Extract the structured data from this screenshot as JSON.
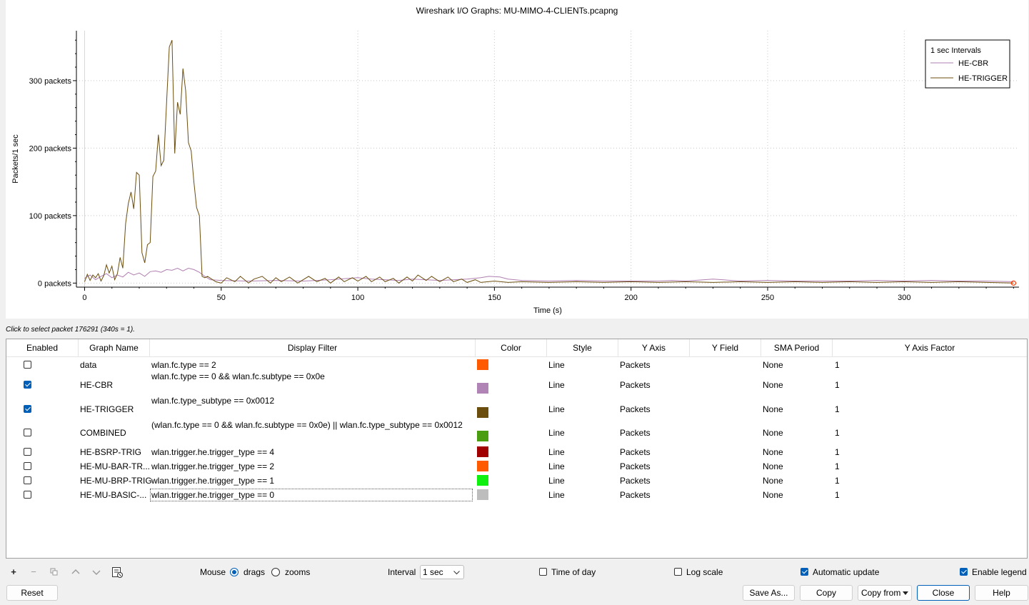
{
  "window": {
    "title": "Wireshark I/O Graphs: MU-MIMO-4-CLIENTs.pcapng"
  },
  "status_hint": "Click to select packet 176291 (340s = 1).",
  "chart_data": {
    "type": "line",
    "title": "Wireshark I/O Graphs: MU-MIMO-4-CLIENTs.pcapng",
    "xlabel": "Time (s)",
    "ylabel": "Packets/1 sec",
    "xlim": [
      -3,
      342
    ],
    "ylim": [
      -6,
      374
    ],
    "xticks": [
      0,
      50,
      100,
      150,
      200,
      250,
      300
    ],
    "yticks": [
      0,
      100,
      200,
      300
    ],
    "ytick_labels": [
      "0 packets",
      "100 packets",
      "200 packets",
      "300 packets"
    ],
    "grid": true,
    "legend": {
      "title": "1 sec Intervals",
      "position": "top-right"
    },
    "series": [
      {
        "name": "HE-CBR",
        "color": "#b07fb0",
        "points": [
          [
            0,
            7
          ],
          [
            2,
            12
          ],
          [
            4,
            5
          ],
          [
            6,
            10
          ],
          [
            8,
            14
          ],
          [
            10,
            8
          ],
          [
            12,
            12
          ],
          [
            14,
            9
          ],
          [
            16,
            16
          ],
          [
            18,
            12
          ],
          [
            20,
            15
          ],
          [
            22,
            10
          ],
          [
            24,
            17
          ],
          [
            26,
            18
          ],
          [
            28,
            16
          ],
          [
            30,
            20
          ],
          [
            32,
            19
          ],
          [
            34,
            22
          ],
          [
            36,
            18
          ],
          [
            38,
            22
          ],
          [
            40,
            20
          ],
          [
            42,
            16
          ],
          [
            44,
            10
          ],
          [
            46,
            5
          ],
          [
            50,
            4
          ],
          [
            60,
            3
          ],
          [
            70,
            4
          ],
          [
            80,
            3
          ],
          [
            90,
            5
          ],
          [
            100,
            8
          ],
          [
            105,
            6
          ],
          [
            110,
            5
          ],
          [
            115,
            4
          ],
          [
            120,
            6
          ],
          [
            130,
            4
          ],
          [
            140,
            6
          ],
          [
            145,
            8
          ],
          [
            148,
            10
          ],
          [
            152,
            9
          ],
          [
            155,
            6
          ],
          [
            160,
            4
          ],
          [
            170,
            3
          ],
          [
            180,
            4
          ],
          [
            190,
            3
          ],
          [
            200,
            3
          ],
          [
            210,
            3
          ],
          [
            215,
            4
          ],
          [
            220,
            3
          ],
          [
            230,
            6
          ],
          [
            240,
            3
          ],
          [
            250,
            4
          ],
          [
            260,
            3
          ],
          [
            270,
            3
          ],
          [
            280,
            3
          ],
          [
            290,
            4
          ],
          [
            300,
            3
          ],
          [
            310,
            4
          ],
          [
            320,
            3
          ],
          [
            330,
            3
          ],
          [
            340,
            2
          ]
        ]
      },
      {
        "name": "HE-TRIGGER",
        "color": "#6b4e0e",
        "points": [
          [
            0,
            2
          ],
          [
            1,
            13
          ],
          [
            2,
            4
          ],
          [
            3,
            12
          ],
          [
            4,
            8
          ],
          [
            5,
            14
          ],
          [
            6,
            3
          ],
          [
            7,
            11
          ],
          [
            8,
            27
          ],
          [
            9,
            15
          ],
          [
            10,
            25
          ],
          [
            11,
            5
          ],
          [
            12,
            14
          ],
          [
            13,
            38
          ],
          [
            14,
            22
          ],
          [
            15,
            88
          ],
          [
            16,
            118
          ],
          [
            17,
            135
          ],
          [
            18,
            110
          ],
          [
            19,
            164
          ],
          [
            20,
            160
          ],
          [
            21,
            45
          ],
          [
            22,
            30
          ],
          [
            23,
            57
          ],
          [
            24,
            60
          ],
          [
            25,
            158
          ],
          [
            26,
            166
          ],
          [
            27,
            220
          ],
          [
            28,
            174
          ],
          [
            29,
            182
          ],
          [
            30,
            268
          ],
          [
            31,
            350
          ],
          [
            32,
            360
          ],
          [
            33,
            192
          ],
          [
            34,
            268
          ],
          [
            35,
            250
          ],
          [
            36,
            318
          ],
          [
            37,
            285
          ],
          [
            38,
            208
          ],
          [
            39,
            196
          ],
          [
            40,
            150
          ],
          [
            41,
            112
          ],
          [
            42,
            100
          ],
          [
            43,
            10
          ],
          [
            44,
            8
          ],
          [
            45,
            10
          ],
          [
            48,
            2
          ],
          [
            50,
            0
          ],
          [
            52,
            8
          ],
          [
            55,
            2
          ],
          [
            57,
            10
          ],
          [
            60,
            0
          ],
          [
            62,
            6
          ],
          [
            65,
            10
          ],
          [
            68,
            0
          ],
          [
            70,
            8
          ],
          [
            72,
            2
          ],
          [
            75,
            9
          ],
          [
            78,
            0
          ],
          [
            82,
            10
          ],
          [
            85,
            2
          ],
          [
            88,
            7
          ],
          [
            90,
            0
          ],
          [
            93,
            9
          ],
          [
            95,
            2
          ],
          [
            98,
            8
          ],
          [
            100,
            3
          ],
          [
            103,
            10
          ],
          [
            105,
            2
          ],
          [
            108,
            9
          ],
          [
            110,
            2
          ],
          [
            113,
            7
          ],
          [
            115,
            0
          ],
          [
            118,
            9
          ],
          [
            120,
            3
          ],
          [
            122,
            12
          ],
          [
            125,
            4
          ],
          [
            127,
            10
          ],
          [
            130,
            2
          ],
          [
            133,
            9
          ],
          [
            135,
            2
          ],
          [
            138,
            6
          ],
          [
            140,
            1
          ],
          [
            143,
            5
          ],
          [
            145,
            1
          ],
          [
            150,
            3
          ],
          [
            155,
            1
          ],
          [
            160,
            2
          ],
          [
            170,
            1
          ],
          [
            180,
            2
          ],
          [
            190,
            1
          ],
          [
            200,
            2
          ],
          [
            210,
            1
          ],
          [
            220,
            2
          ],
          [
            230,
            1
          ],
          [
            240,
            2
          ],
          [
            250,
            1
          ],
          [
            260,
            2
          ],
          [
            270,
            1
          ],
          [
            280,
            2
          ],
          [
            290,
            1
          ],
          [
            300,
            2
          ],
          [
            310,
            1
          ],
          [
            320,
            2
          ],
          [
            330,
            1
          ],
          [
            340,
            0
          ]
        ]
      }
    ]
  },
  "table": {
    "headers": [
      "Enabled",
      "Graph Name",
      "Display Filter",
      "Color",
      "Style",
      "Y Axis",
      "Y Field",
      "SMA Period",
      "Y Axis Factor"
    ],
    "rows": [
      {
        "enabled": false,
        "name": "data",
        "filter": "wlan.fc.type == 2",
        "color": "#ff5a00",
        "style": "Line",
        "y_axis": "Packets",
        "y_field": "",
        "sma": "None",
        "factor": "1"
      },
      {
        "enabled": true,
        "name": "HE-CBR",
        "filter": "wlan.fc.type == 0 && wlan.fc.subtype == 0x0e",
        "color": "#b085b5",
        "style": "Line",
        "y_axis": "Packets",
        "y_field": "",
        "sma": "None",
        "factor": "1"
      },
      {
        "enabled": true,
        "name": "HE-TRIGGER",
        "filter": "wlan.fc.type_subtype == 0x0012",
        "color": "#6b4e0e",
        "style": "Line",
        "y_axis": "Packets",
        "y_field": "",
        "sma": "None",
        "factor": "1"
      },
      {
        "enabled": false,
        "name": "COMBINED",
        "filter": "(wlan.fc.type == 0 && wlan.fc.subtype == 0x0e) || wlan.fc.type_subtype == 0x0012",
        "color": "#4a9c11",
        "style": "Line",
        "y_axis": "Packets",
        "y_field": "",
        "sma": "None",
        "factor": "1"
      },
      {
        "enabled": false,
        "name": "HE-BSRP-TRIG",
        "filter": "wlan.trigger.he.trigger_type == 4",
        "color": "#a00000",
        "style": "Line",
        "y_axis": "Packets",
        "y_field": "",
        "sma": "None",
        "factor": "1"
      },
      {
        "enabled": false,
        "name": "HE-MU-BAR-TR...",
        "filter": "wlan.trigger.he.trigger_type == 2",
        "color": "#ff5a00",
        "style": "Line",
        "y_axis": "Packets",
        "y_field": "",
        "sma": "None",
        "factor": "1"
      },
      {
        "enabled": false,
        "name": "HE-MU-BRP-TRIG",
        "filter": "wlan.trigger.he.trigger_type == 1",
        "color": "#10f010",
        "style": "Line",
        "y_axis": "Packets",
        "y_field": "",
        "sma": "None",
        "factor": "1"
      },
      {
        "enabled": false,
        "name": "HE-MU-BASIC-...",
        "filter": "wlan.trigger.he.trigger_type == 0",
        "color": "#bdbdbd",
        "style": "Line",
        "y_axis": "Packets",
        "y_field": "",
        "sma": "None",
        "factor": "1"
      }
    ]
  },
  "controls": {
    "mouse_label": "Mouse",
    "drags_label": "drags",
    "zooms_label": "zooms",
    "mouse_mode": "drags",
    "interval_label": "Interval",
    "interval_value": "1 sec",
    "time_of_day_label": "Time of day",
    "time_of_day": false,
    "log_scale_label": "Log scale",
    "log_scale": false,
    "auto_update_label": "Automatic update",
    "auto_update": true,
    "enable_legend_label": "Enable legend",
    "enable_legend": true
  },
  "buttons": {
    "reset": "Reset",
    "save_as": "Save As...",
    "copy": "Copy",
    "copy_from": "Copy from",
    "close": "Close",
    "help": "Help"
  },
  "toolbar_icons": [
    "add-icon",
    "remove-icon",
    "copy-graph-icon",
    "move-up-icon",
    "move-down-icon",
    "clear-icon"
  ]
}
